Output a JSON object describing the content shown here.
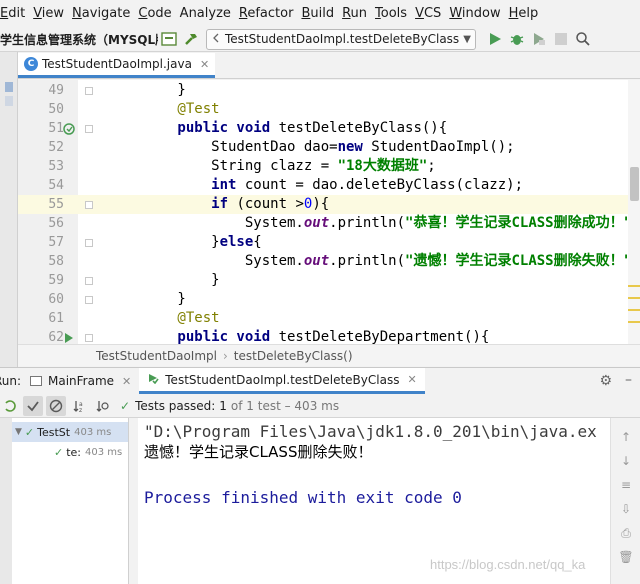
{
  "menu": {
    "items": [
      {
        "first": "E",
        "rest": "dit"
      },
      {
        "first": "V",
        "rest": "iew"
      },
      {
        "first": "N",
        "rest": "avigate"
      },
      {
        "first": "C",
        "rest": "ode"
      },
      {
        "first": "",
        "rest": "Analyze"
      },
      {
        "first": "R",
        "rest": "efactor"
      },
      {
        "first": "B",
        "rest": "uild"
      },
      {
        "first": "R",
        "rest": "un"
      },
      {
        "first": "T",
        "rest": "ools"
      },
      {
        "first": "V",
        "rest": "CS"
      },
      {
        "first": "W",
        "rest": "indow"
      },
      {
        "first": "H",
        "rest": "elp"
      }
    ]
  },
  "toolbar": {
    "project_name": "学生信息管理系统（MYSQL版",
    "run_config": "TestStudentDaoImpl.testDeleteByClass"
  },
  "editor": {
    "tab_label": "TestStudentDaoImpl.java",
    "tab_badge": "C",
    "lines": [
      {
        "n": "49",
        "parts": [
          [
            "",
            "        }"
          ]
        ]
      },
      {
        "n": "50",
        "parts": [
          [
            "ann",
            "        @Test"
          ]
        ]
      },
      {
        "n": "51",
        "parts": [
          [
            "kw",
            "        public void "
          ],
          [
            "",
            "testDeleteByClass(){"
          ]
        ]
      },
      {
        "n": "52",
        "parts": [
          [
            "",
            "            StudentDao dao="
          ],
          [
            "kw",
            "new "
          ],
          [
            "",
            "StudentDaoImpl();"
          ]
        ]
      },
      {
        "n": "53",
        "parts": [
          [
            "",
            "            String clazz = "
          ],
          [
            "str",
            "\"18大数据班\""
          ],
          [
            "",
            ";"
          ]
        ]
      },
      {
        "n": "54",
        "parts": [
          [
            "kw",
            "            int "
          ],
          [
            "",
            "count = dao.deleteByClass(clazz);"
          ]
        ]
      },
      {
        "n": "55",
        "parts": [
          [
            "kw",
            "            if "
          ],
          [
            "",
            "(count >"
          ],
          [
            "num",
            "0"
          ],
          [
            "",
            "){"
          ]
        ]
      },
      {
        "n": "56",
        "parts": [
          [
            "",
            "                System."
          ],
          [
            "fld",
            "out"
          ],
          [
            "",
            ".println("
          ],
          [
            "str",
            "\"恭喜！学生记录CLASS删除成功！\""
          ]
        ]
      },
      {
        "n": "57",
        "parts": [
          [
            "",
            "            }"
          ],
          [
            "kw",
            "else"
          ],
          [
            "",
            "{"
          ]
        ]
      },
      {
        "n": "58",
        "parts": [
          [
            "",
            "                System."
          ],
          [
            "fld",
            "out"
          ],
          [
            "",
            ".println("
          ],
          [
            "str",
            "\"遗憾！学生记录CLASS删除失败！\""
          ]
        ]
      },
      {
        "n": "59",
        "parts": [
          [
            "",
            "            }"
          ]
        ]
      },
      {
        "n": "60",
        "parts": [
          [
            "",
            "        }"
          ]
        ]
      },
      {
        "n": "61",
        "parts": [
          [
            "ann",
            "        @Test"
          ]
        ]
      },
      {
        "n": "62",
        "parts": [
          [
            "kw",
            "        public void "
          ],
          [
            "",
            "testDeleteByDepartment(){"
          ]
        ]
      }
    ]
  },
  "breadcrumb": {
    "class_name": "TestStudentDaoImpl",
    "separator": "›",
    "method_name": "testDeleteByClass()"
  },
  "run_panel": {
    "label": "Run:",
    "tabs": [
      {
        "label": "MainFrame"
      },
      {
        "label": "TestStudentDaoImpl.testDeleteByClass"
      }
    ],
    "status_passed": "Tests passed:",
    "status_count": "1",
    "status_rest": "of 1 test – 403 ms",
    "tree": [
      {
        "label": "TestSt",
        "time": "403 ms"
      },
      {
        "label": "te:",
        "time": "403 ms"
      }
    ],
    "console": [
      "\"D:\\Program Files\\Java\\jdk1.8.0_201\\bin\\java.ex",
      "遗憾！学生记录CLASS删除失败！",
      "",
      "Process finished with exit code 0"
    ],
    "watermark": "https://blog.csdn.net/qq_ka"
  },
  "colors": {
    "keyword": "#000080",
    "string": "#008000",
    "annotation": "#808000",
    "pass_green": "#499c54",
    "accent_blue": "#4083c9"
  }
}
